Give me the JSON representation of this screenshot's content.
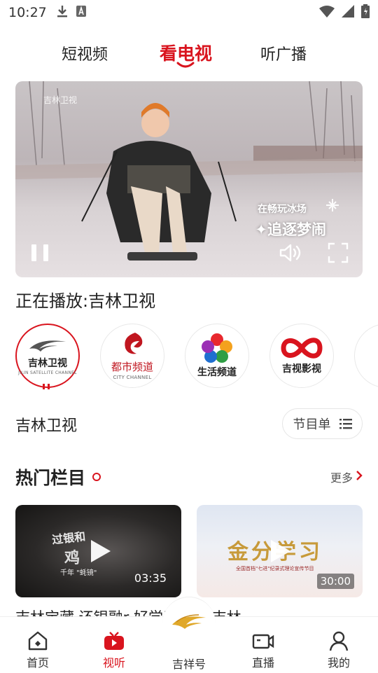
{
  "status": {
    "time": "10:27"
  },
  "tabs": [
    {
      "label": "短视频"
    },
    {
      "label": "看电视",
      "active": true
    },
    {
      "label": "听广播"
    }
  ],
  "player": {
    "watermark": "吉林卫视",
    "caption_small": "在畅玩冰场",
    "caption_big": "✦追逐梦闹"
  },
  "now_playing": "正在播放:吉林卫视",
  "channels": [
    {
      "name": "吉林卫视",
      "sub": "JILIN SATELLITE CHANNEL",
      "active": true
    },
    {
      "name": "都市频道",
      "sub": "CITY CHANNEL"
    },
    {
      "name": "生活频道",
      "sub": ""
    },
    {
      "name": "吉视影视",
      "sub": ""
    }
  ],
  "current_channel": "吉林卫视",
  "schedule_button": "节目单",
  "hot": {
    "title": "热门栏目",
    "more": "更多"
  },
  "cards": [
    {
      "caption": "过银和",
      "caption2": "鸡",
      "caption3": "千年 \"蚝镜\"",
      "duration": "03:35"
    },
    {
      "caption": "金分学习",
      "caption2": "全国首档\"七进\"纪录式理论宣传节目",
      "duration": "30:00"
    }
  ],
  "card_titles": "吉林宝藏      还银融r         好学习      看见吉林",
  "nav": [
    {
      "label": "首页"
    },
    {
      "label": "视听",
      "active": true
    },
    {
      "label": "吉祥号"
    },
    {
      "label": "直播"
    },
    {
      "label": "我的"
    }
  ],
  "colors": {
    "accent": "#d9141e"
  }
}
